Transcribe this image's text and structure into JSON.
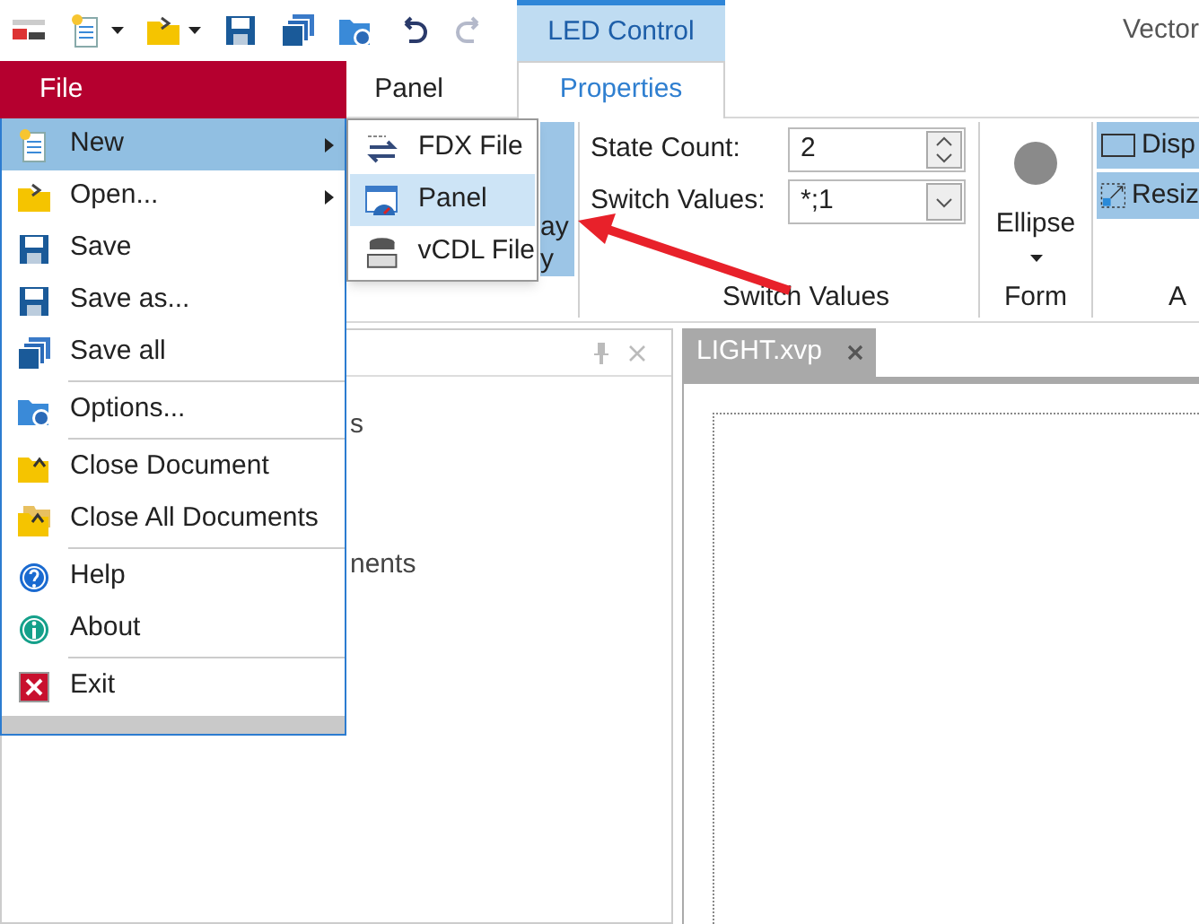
{
  "toolbar": [
    {
      "kind": "app",
      "disabled": false
    },
    {
      "kind": "new",
      "disabled": false,
      "dropdown": true
    },
    {
      "kind": "open",
      "disabled": false,
      "dropdown": true
    },
    {
      "kind": "save",
      "disabled": false
    },
    {
      "kind": "saveall",
      "disabled": false
    },
    {
      "kind": "options",
      "disabled": false
    },
    {
      "kind": "undo",
      "disabled": false
    },
    {
      "kind": "redo",
      "disabled": true
    }
  ],
  "title": "Vector",
  "contextual_tab_group": "LED Control",
  "ribbon_tabs": [
    {
      "label": "Panel",
      "selected": false
    },
    {
      "label": "Properties",
      "selected": true
    }
  ],
  "ribbon": {
    "partial_button": {
      "lines": [
        "ay",
        "y"
      ],
      "selected": true
    },
    "switch_values": {
      "state_count_label": "State Count:",
      "state_count": "2",
      "switch_values_label": "Switch Values:",
      "switch_values": "*;1",
      "group_label": "Switch Values"
    },
    "form": {
      "shape": "Ellipse",
      "group_label": "Form"
    },
    "appearance": {
      "items": [
        {
          "label": "Disp",
          "kind": "rect",
          "selected": true
        },
        {
          "label": "Resiz",
          "kind": "resize",
          "selected": true
        }
      ],
      "group_label": "A"
    }
  },
  "left_pane": {
    "fragments": [
      "s",
      "nents"
    ]
  },
  "document_tabs": [
    {
      "label": "LIGHT.xvp",
      "selected": true
    }
  ],
  "file_menu": {
    "title": "File",
    "items": [
      {
        "label": "New",
        "kind": "new",
        "submenu": true,
        "selected": true,
        "separator_before": false
      },
      {
        "label": "Open...",
        "kind": "open",
        "submenu": true,
        "selected": false,
        "separator_before": false
      },
      {
        "label": "Save",
        "kind": "save",
        "submenu": false,
        "selected": false,
        "separator_before": false
      },
      {
        "label": "Save as...",
        "kind": "saveas",
        "submenu": false,
        "selected": false,
        "separator_before": false
      },
      {
        "label": "Save all",
        "kind": "saveall",
        "submenu": false,
        "selected": false,
        "separator_before": false
      },
      {
        "label": "Options...",
        "kind": "options",
        "submenu": false,
        "selected": false,
        "separator_before": true
      },
      {
        "label": "Close Document",
        "kind": "close",
        "submenu": false,
        "selected": false,
        "separator_before": true
      },
      {
        "label": "Close All Documents",
        "kind": "closeall",
        "submenu": false,
        "selected": false,
        "separator_before": false
      },
      {
        "label": "Help",
        "kind": "help",
        "submenu": false,
        "selected": false,
        "separator_before": true
      },
      {
        "label": "About",
        "kind": "about",
        "submenu": false,
        "selected": false,
        "separator_before": false
      },
      {
        "label": "Exit",
        "kind": "exit",
        "submenu": false,
        "selected": false,
        "separator_before": true
      }
    ]
  },
  "submenu": [
    {
      "label": "FDX File",
      "kind": "fdx",
      "selected": false
    },
    {
      "label": "Panel",
      "kind": "panel",
      "selected": true
    },
    {
      "label": "vCDL File",
      "kind": "vcdl",
      "selected": false
    }
  ]
}
